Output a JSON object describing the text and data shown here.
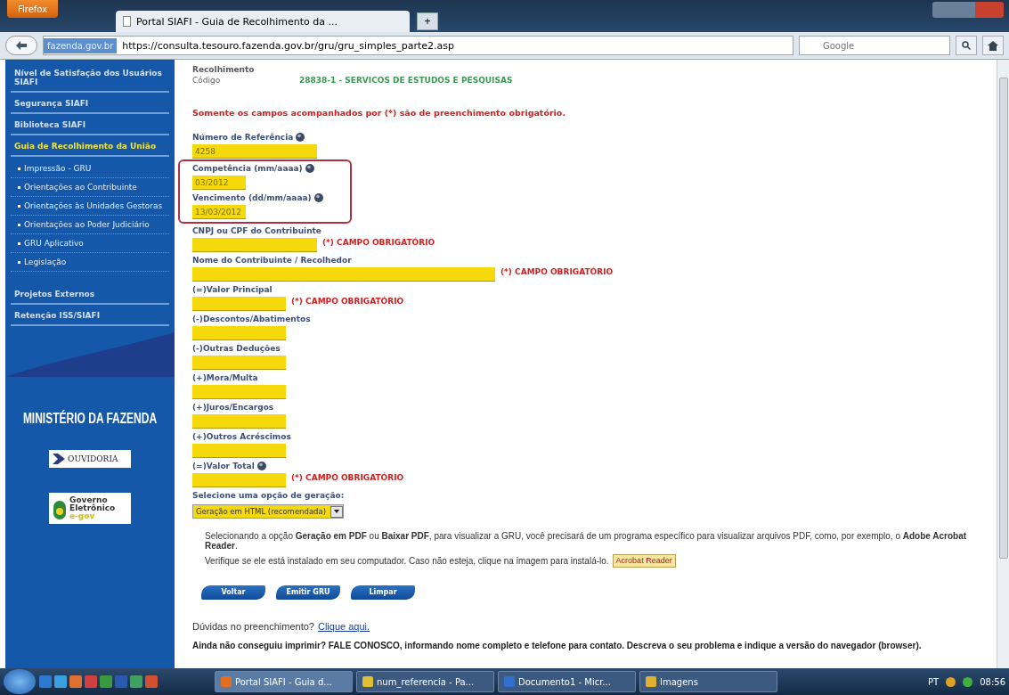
{
  "browser": {
    "menu_button": "Firefox",
    "tabs": [
      {
        "label": "Portal SIAFI - Guia de Recolhimento da ...",
        "selected": true
      }
    ],
    "new_tab": "+",
    "site_badge": "fazenda.gov.br",
    "url": "https://consulta.tesouro.fazenda.gov.br/gru/gru_simples_parte2.asp",
    "search_placeholder": "Google"
  },
  "sidebar": {
    "items": [
      {
        "label": "Nível de Satisfação dos Usuários SIAFI",
        "selected": false
      },
      {
        "label": "Segurança SIAFI",
        "selected": false
      },
      {
        "label": "Biblioteca SIAFI",
        "selected": false
      },
      {
        "label": "Guia de Recolhimento da União",
        "selected": true,
        "children": [
          {
            "label": "Impressão - GRU"
          },
          {
            "label": "Orientações ao Contribuinte"
          },
          {
            "label": "Orientações às Unidades Gestoras"
          },
          {
            "label": "Orientações ao Poder Judiciário"
          },
          {
            "label": "GRU Aplicativo"
          },
          {
            "label": "Legislação"
          }
        ]
      },
      {
        "label": "Projetos Externos",
        "selected": false
      },
      {
        "label": "Retenção ISS/SIAFI",
        "selected": false
      }
    ],
    "logos": {
      "ministry": "MINISTÉRIO DA FAZENDA",
      "ouvidoria": "OUVIDORIA",
      "egov": [
        "Governo",
        "Eletrônico",
        "e-gov"
      ]
    }
  },
  "form": {
    "heading": "Recolhimento",
    "code_label": "Código",
    "code_value": "28838-1 - SERVICOS DE ESTUDOS E PESQUISAS",
    "notice": "Somente os campos acompanhados por (*) são de preenchimento obrigatório.",
    "fields": [
      {
        "label": "Número de Referência",
        "value": "4258",
        "kind": "medium",
        "help": true,
        "highlighted": false
      },
      {
        "label": "Competência (mm/aaaa)",
        "value": "03/2012",
        "kind": "tiny",
        "help": true,
        "highlighted": true
      },
      {
        "label": "Vencimento (dd/mm/aaaa)",
        "value": "13/03/2012",
        "kind": "tiny",
        "help": true,
        "highlighted": true
      },
      {
        "label": "CNPJ ou CPF do Contribuinte",
        "kind": "medium",
        "required": "(*) CAMPO OBRIGATÓRIO",
        "help": false,
        "highlighted": false
      },
      {
        "label": "Nome do Contribuinte / Recolhedor",
        "kind": "long",
        "required": "(*) CAMPO OBRIGATÓRIO",
        "help": false,
        "highlighted": false
      },
      {
        "label": "(=)Valor Principal",
        "kind": "short",
        "required": "(*) CAMPO OBRIGATÓRIO",
        "help": false,
        "highlighted": false
      },
      {
        "label": "(-)Descontos/Abatimentos",
        "kind": "short",
        "help": false,
        "highlighted": false
      },
      {
        "label": "(-)Outras Deduções",
        "kind": "short",
        "help": false,
        "highlighted": false
      },
      {
        "label": "(+)Mora/Multa",
        "kind": "short",
        "help": false,
        "highlighted": false
      },
      {
        "label": "(+)Juros/Encargos",
        "kind": "short",
        "help": false,
        "highlighted": false
      },
      {
        "label": "(+)Outros Acréscimos",
        "kind": "short",
        "help": false,
        "highlighted": false
      },
      {
        "label": "(=)Valor Total",
        "kind": "short",
        "required": "(*) CAMPO OBRIGATÓRIO",
        "help": true,
        "highlighted": false
      }
    ],
    "generation_label": "Selecione uma opção de geração:",
    "generation_value": "Geração em HTML (recomendada)",
    "info": "Selecionando a opção **Geração em PDF** ou **Baixar PDF**, para visualizar a GRU, você precisará de um programa específico para visualizar arquivos PDF, como, por exemplo, o **Adobe Acrobat Reader**.",
    "check_text": "Verifique se ele está instalado em seu computador. Caso não esteja, clique na imagem para instalá-lo.",
    "reader_badge": "Acrobat Reader",
    "buttons": [
      "Voltar",
      "Emitir GRU",
      "Limpar"
    ],
    "help_text": "Dúvidas no preenchimento?",
    "help_link": "Clique aqui.",
    "contact_text": "Ainda não conseguiu imprimir? FALE CONOSCO, informando nome completo e telefone para contato. Descreva o seu problema e indique a versão do navegador (browser)."
  },
  "taskbar": {
    "tasks": [
      {
        "label": "Portal SIAFI - Guia d...",
        "selected": true
      },
      {
        "label": "num_referencia - Pa...",
        "selected": false
      },
      {
        "label": "Documento1 - Micr...",
        "selected": false
      },
      {
        "label": "Imagens",
        "selected": false
      }
    ],
    "language": "PT",
    "clock": "08:56"
  }
}
